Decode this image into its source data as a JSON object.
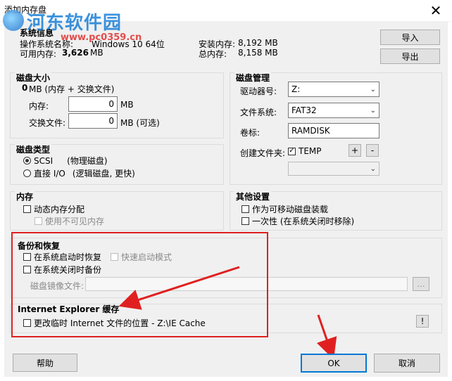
{
  "window": {
    "title": "添加内存盘",
    "close_label": "✕"
  },
  "watermark": {
    "text": "河东软件园",
    "sub": "www.pc0359.cn"
  },
  "system_info": {
    "title": "系统信息",
    "os_label": "操作系统名称:",
    "os_value": "Windows 10 64位",
    "avail_label": "可用内存:",
    "avail_value": "3,626",
    "avail_unit": "MB",
    "installed_label": "安装内存:",
    "installed_value": "8,192 MB",
    "total_label": "总内存:",
    "total_value": "8,158 MB"
  },
  "buttons": {
    "import": "导入",
    "export": "导出",
    "help": "帮助",
    "ok": "OK",
    "cancel": "取消",
    "plus": "+",
    "minus": "-",
    "browse": "...",
    "warn": "!"
  },
  "disk_size": {
    "title": "磁盘大小",
    "total_value": "0",
    "total_text": "MB (内存 + 交换文件)",
    "memory_label": "内存:",
    "memory_value": "0",
    "memory_unit": "MB",
    "swap_label": "交换文件:",
    "swap_value": "0",
    "swap_unit": "MB (可选)"
  },
  "disk_manage": {
    "title": "磁盘管理",
    "drive_label": "驱动器号:",
    "drive_value": "Z:",
    "fs_label": "文件系统:",
    "fs_value": "FAT32",
    "volume_label": "卷标:",
    "volume_value": "RAMDISK",
    "create_folder_label": "创建文件夹:",
    "folder_value": "TEMP",
    "folder_checked": true
  },
  "disk_type": {
    "title": "磁盘类型",
    "scsi_label": "SCSI",
    "scsi_desc": "(物理磁盘)",
    "scsi_selected": true,
    "direct_label": "直接 I/O",
    "direct_desc": "(逻辑磁盘, 更快)",
    "direct_selected": false
  },
  "memory": {
    "title": "内存",
    "dynamic_label": "动态内存分配",
    "invisible_label": "使用不可见内存"
  },
  "other": {
    "title": "其他设置",
    "removable_label": "作为可移动磁盘装载",
    "onetime_label": "一次性 (在系统关闭时移除)"
  },
  "backup": {
    "title": "备份和恢复",
    "restore_on_start": "在系统启动时恢复",
    "fast_start": "快速启动模式",
    "backup_on_shutdown": "在系统关闭时备份",
    "image_label": "磁盘镜像文件:",
    "image_value": ""
  },
  "ie_cache": {
    "title": "Internet Explorer 缓存",
    "change_label": "更改临时 Internet 文件的位置 - Z:\\IE Cache"
  },
  "colors": {
    "accent": "#0078d7",
    "annotation": "#e02020"
  }
}
